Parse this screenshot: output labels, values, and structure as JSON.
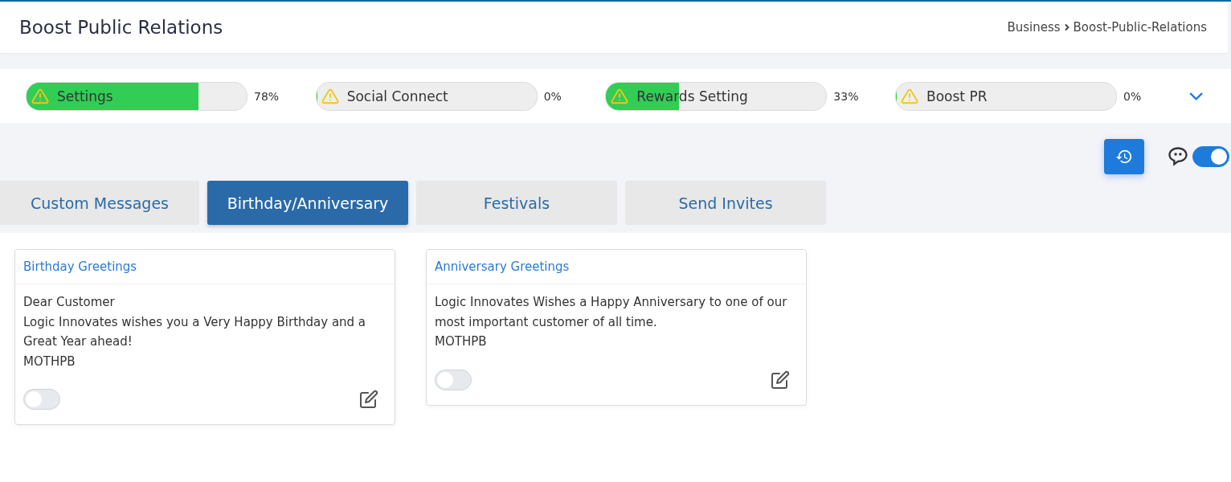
{
  "header": {
    "title": "Boost Public Relations",
    "breadcrumb": [
      "Business",
      "Boost-Public-Relations"
    ]
  },
  "progress": [
    {
      "label": "Settings",
      "level": 0.78,
      "reading": "78%"
    },
    {
      "label": "Social Connect",
      "level": 0,
      "reading": "0%"
    },
    {
      "label": "Rewards Setting",
      "level": 0.33,
      "reading": "33%"
    },
    {
      "label": "Boost PR",
      "level": 0,
      "reading": "0%"
    }
  ],
  "chat_toggle": {
    "on": true
  },
  "tabs": [
    {
      "label": "Custom Messages",
      "selected": false
    },
    {
      "label": "Birthday/Anniversary",
      "selected": true
    },
    {
      "label": "Festivals",
      "selected": false
    },
    {
      "label": "Send Invites",
      "selected": false
    }
  ],
  "cards": [
    {
      "title": "Birthday Greetings",
      "lines": [
        "Dear Customer",
        "Logic Innovates wishes you a Very Happy Birthday and a Great Year ahead!",
        "MOTHPB"
      ],
      "on": false
    },
    {
      "title": "Anniversary Greetings",
      "lines": [
        "Logic Innovates Wishes a Happy Anniversary to one of our most important customer of all time.",
        "MOTHPB"
      ],
      "on": false
    }
  ]
}
